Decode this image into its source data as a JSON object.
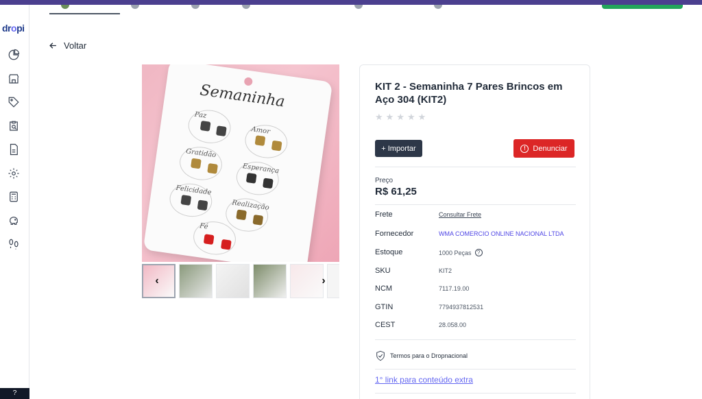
{
  "app": {
    "logo_text_left": "dr",
    "logo_text_mid": "o",
    "logo_text_right": "pi"
  },
  "sidebar": {
    "icons": [
      "dashboard-icon",
      "store-icon",
      "tag-icon",
      "clipboard-search-icon",
      "document-icon",
      "settings-icon",
      "calculator-icon",
      "piggy-bank-icon",
      "footprints-icon"
    ],
    "help_label": "?"
  },
  "back": {
    "label": "Voltar"
  },
  "product": {
    "title": "KIT 2 - Semaninha 7 Pares Brincos em Aço 304 (KIT2)",
    "rating_stars": 0,
    "rating_max": 5,
    "import_label": "Importar",
    "import_prefix": "+",
    "report_label": "Denunciar",
    "price_label": "Preço",
    "price_value": "R$ 61,25",
    "details": [
      {
        "key": "Frete",
        "value": "Consultar Frete",
        "type": "link"
      },
      {
        "key": "Fornecedor",
        "value": "WMA COMERCIO ONLINE NACIONAL LTDA",
        "type": "supplier"
      },
      {
        "key": "Estoque",
        "value": "1000 Peças",
        "type": "stock"
      },
      {
        "key": "SKU",
        "value": "KIT2",
        "type": "text"
      },
      {
        "key": "NCM",
        "value": "7117.19.00",
        "type": "text"
      },
      {
        "key": "GTIN",
        "value": "7794937812531",
        "type": "text"
      },
      {
        "key": "CEST",
        "value": "28.058.00",
        "type": "text"
      }
    ],
    "terms_label": "Termos para o Dropnacional",
    "extra_link": "1° link para conteúdo extra"
  },
  "image": {
    "card_title": "Semaninha",
    "labels": [
      "Paz",
      "Amor",
      "Gratidão",
      "Esperança",
      "Felicidade",
      "Realização",
      "Fé"
    ],
    "thumbnail_count": 6,
    "prev_arrow": "‹",
    "next_arrow": "›"
  },
  "colors": {
    "primary_dark": "#2d3748",
    "danger": "#dc2626",
    "accent": "#6366f1",
    "brand_bar": "#4b3f8f",
    "success": "#22a55a"
  }
}
